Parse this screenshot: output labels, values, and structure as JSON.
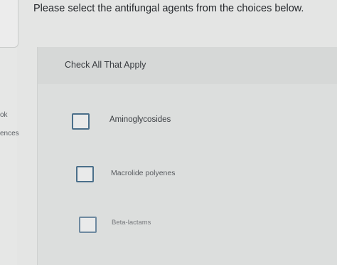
{
  "sidebar": {
    "links": [
      "ok",
      "ences"
    ]
  },
  "question": {
    "prompt": "Please select the antifungal agents from the choices below."
  },
  "answers": {
    "instruction": "Check All That Apply",
    "options": [
      {
        "label": "Aminoglycosides",
        "checked": false
      },
      {
        "label": "Macrolide polyenes",
        "checked": false
      },
      {
        "label": "Beta-lactams",
        "checked": false
      }
    ]
  },
  "colors": {
    "checkbox_border": "#4b6f8a",
    "panel_background": "#dcdedd"
  }
}
